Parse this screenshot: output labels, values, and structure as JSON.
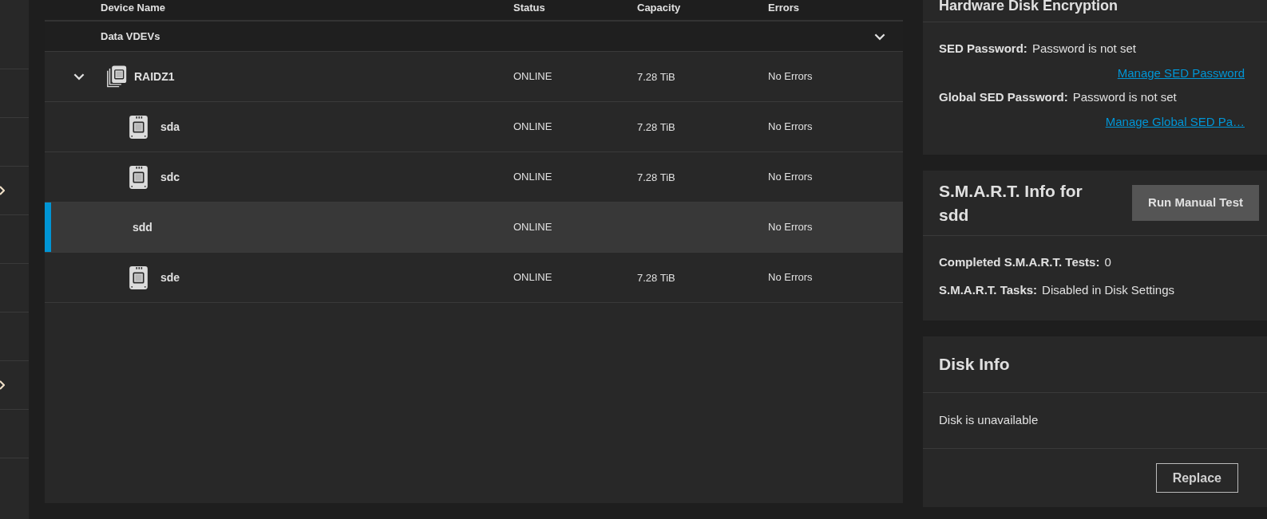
{
  "sidebar": {
    "items": [
      {
        "expandable": false
      },
      {
        "expandable": false
      },
      {
        "expandable": false
      },
      {
        "expandable": true
      },
      {
        "expandable": false
      },
      {
        "expandable": false
      },
      {
        "expandable": false
      },
      {
        "expandable": true
      },
      {
        "expandable": false
      }
    ]
  },
  "table": {
    "columns": [
      "Device Name",
      "Status",
      "Capacity",
      "Errors"
    ],
    "group": {
      "label": "Data VDEVs",
      "expanded": true
    },
    "rows": [
      {
        "kind": "vdev",
        "name": "RAIDZ1",
        "status": "ONLINE",
        "capacity": "7.28 TiB",
        "errors": "No Errors",
        "expanded": true,
        "selected": false,
        "children": [
          {
            "kind": "disk",
            "name": "sda",
            "status": "ONLINE",
            "capacity": "7.28 TiB",
            "errors": "No Errors",
            "selected": false
          },
          {
            "kind": "disk",
            "name": "sdc",
            "status": "ONLINE",
            "capacity": "7.28 TiB",
            "errors": "No Errors",
            "selected": false
          },
          {
            "kind": "missing",
            "name": "sdd",
            "status": "ONLINE",
            "errors": "No Errors",
            "selected": true
          },
          {
            "kind": "disk",
            "name": "sde",
            "status": "ONLINE",
            "capacity": "7.28 TiB",
            "errors": "No Errors",
            "selected": false
          }
        ]
      }
    ]
  },
  "encryption": {
    "title": "Hardware Disk Encryption",
    "fields": [
      {
        "label": "SED Password:",
        "value": "Password is not set",
        "link": "Manage SED Password"
      },
      {
        "label": "Global SED Password:",
        "value": "Password is not set",
        "link": "Manage Global SED Pa…"
      }
    ]
  },
  "smart": {
    "title": "S.M.A.R.T. Info for sdd",
    "button": "Run Manual Test",
    "fields": [
      {
        "label": "Completed S.M.A.R.T. Tests:",
        "value": "0"
      },
      {
        "label": "S.M.A.R.T. Tasks:",
        "value": "Disabled in Disk Settings"
      }
    ]
  },
  "disk_info": {
    "title": "Disk Info",
    "message": "Disk is unavailable",
    "button": "Replace"
  }
}
